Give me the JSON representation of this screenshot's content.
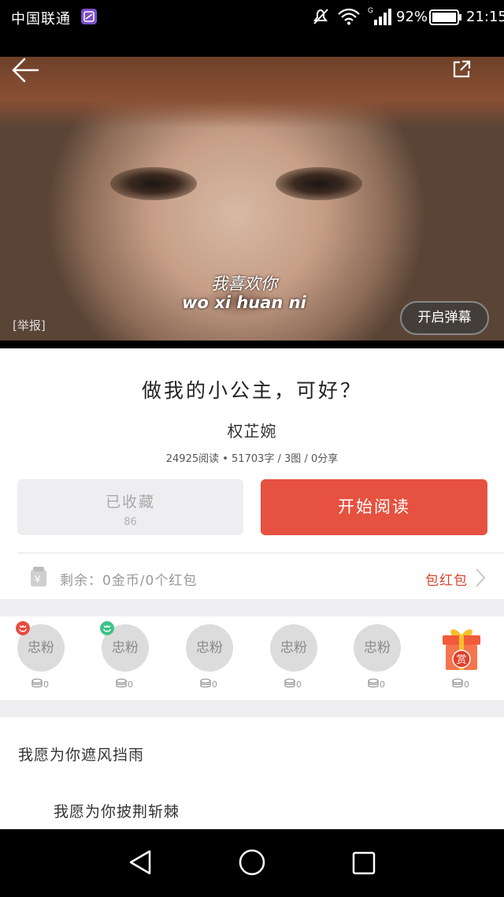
{
  "status_bar": {
    "carrier": "中国联通",
    "network_type": "G",
    "battery_percent": "92%",
    "time": "21:15",
    "icons": [
      "app-notification-icon",
      "mute-icon",
      "wifi-icon",
      "signal-icon",
      "battery-icon"
    ]
  },
  "cover": {
    "subtitle_cn": "我喜欢你",
    "subtitle_pinyin": "wo xi huan ni",
    "report_label": "[举报]",
    "danmaku_button": "开启弹幕",
    "icons": [
      "back-arrow-icon",
      "share-icon"
    ]
  },
  "book": {
    "title": "做我的小公主，可好？",
    "author": "权芷婉",
    "stats": "24925阅读 • 51703字 / 3图 / 0分享"
  },
  "actions": {
    "favorite_label": "已收藏",
    "favorite_count": "86",
    "read_label": "开始阅读"
  },
  "balance": {
    "text": "剩余：0金币/0个红包",
    "redpack_label": "包红包",
    "icons": [
      "wallet-icon",
      "chevron-right-icon"
    ]
  },
  "fans": [
    {
      "label": "忠粉",
      "count": "0",
      "badge": "red"
    },
    {
      "label": "忠粉",
      "count": "0",
      "badge": "green"
    },
    {
      "label": "忠粉",
      "count": "0",
      "badge": ""
    },
    {
      "label": "忠粉",
      "count": "0",
      "badge": ""
    },
    {
      "label": "忠粉",
      "count": "0",
      "badge": ""
    }
  ],
  "reward": {
    "gift_char": "赏",
    "count": "0"
  },
  "excerpt": {
    "line1": "我愿为你遮风挡雨",
    "line2": "我愿为你披荆斩棘"
  },
  "colors": {
    "accent_red": "#e65140",
    "redpack_red": "#d9442f",
    "badge_red": "#e84c3d",
    "badge_green": "#3cc48a"
  }
}
